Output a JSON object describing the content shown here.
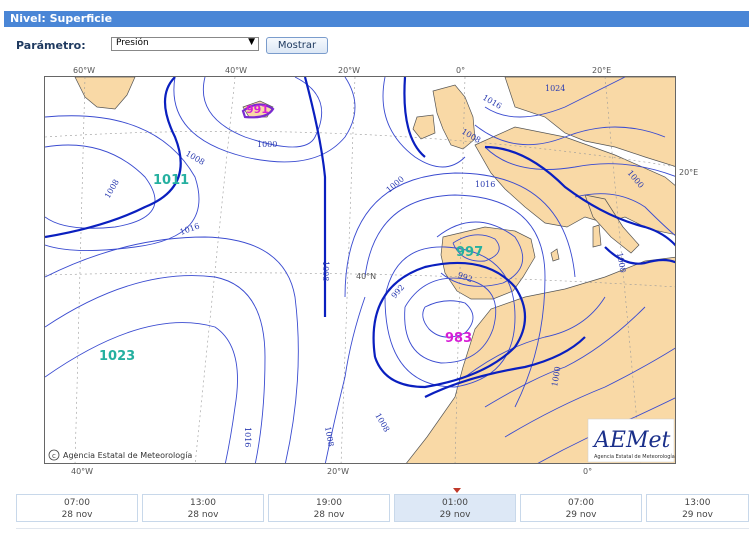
{
  "header": {
    "title": "Nivel: Superficie"
  },
  "controls": {
    "param_label": "Parámetro:",
    "param_value": "Presión",
    "show_button": "Mostrar"
  },
  "map": {
    "top_lon_labels": [
      "60°W",
      "40°W",
      "20°W",
      "0°",
      "20°E"
    ],
    "bottom_lon_labels": [
      "40°W",
      "20°W",
      "0°"
    ],
    "lat_labels": [
      "40°N"
    ],
    "right_label": "20°E",
    "isobar_labels": [
      "1024",
      "1016",
      "1008",
      "1000",
      "1008",
      "1016",
      "1008",
      "1000",
      "1008",
      "1016",
      "992",
      "992",
      "1000",
      "1008",
      "1016",
      "1008",
      "1000",
      "1008"
    ],
    "centers": [
      {
        "value": "1011",
        "color": "#25b0a0"
      },
      {
        "value": "1023",
        "color": "#25b0a0"
      },
      {
        "value": "997",
        "color": "#25b0a0"
      },
      {
        "value": "983",
        "color": "#d61ed6"
      },
      {
        "value": "991",
        "color": "#d61ed6"
      }
    ],
    "copyright": "Agencia Estatal de Meteorología",
    "logo_text": "AEMet",
    "logo_subtext": "Agencia Estatal de Meteorología"
  },
  "timeline": [
    {
      "time": "07:00",
      "date": "28 nov",
      "selected": false
    },
    {
      "time": "13:00",
      "date": "28 nov",
      "selected": false
    },
    {
      "time": "19:00",
      "date": "28 nov",
      "selected": false
    },
    {
      "time": "01:00",
      "date": "29 nov",
      "selected": true
    },
    {
      "time": "07:00",
      "date": "29 nov",
      "selected": false
    },
    {
      "time": "13:00",
      "date": "29 nov",
      "selected": false
    }
  ],
  "colors": {
    "land": "#f9d9a6",
    "isobar": "#3344cc",
    "isobar_bold": "#0a1fbf",
    "header": "#4a86d6"
  }
}
